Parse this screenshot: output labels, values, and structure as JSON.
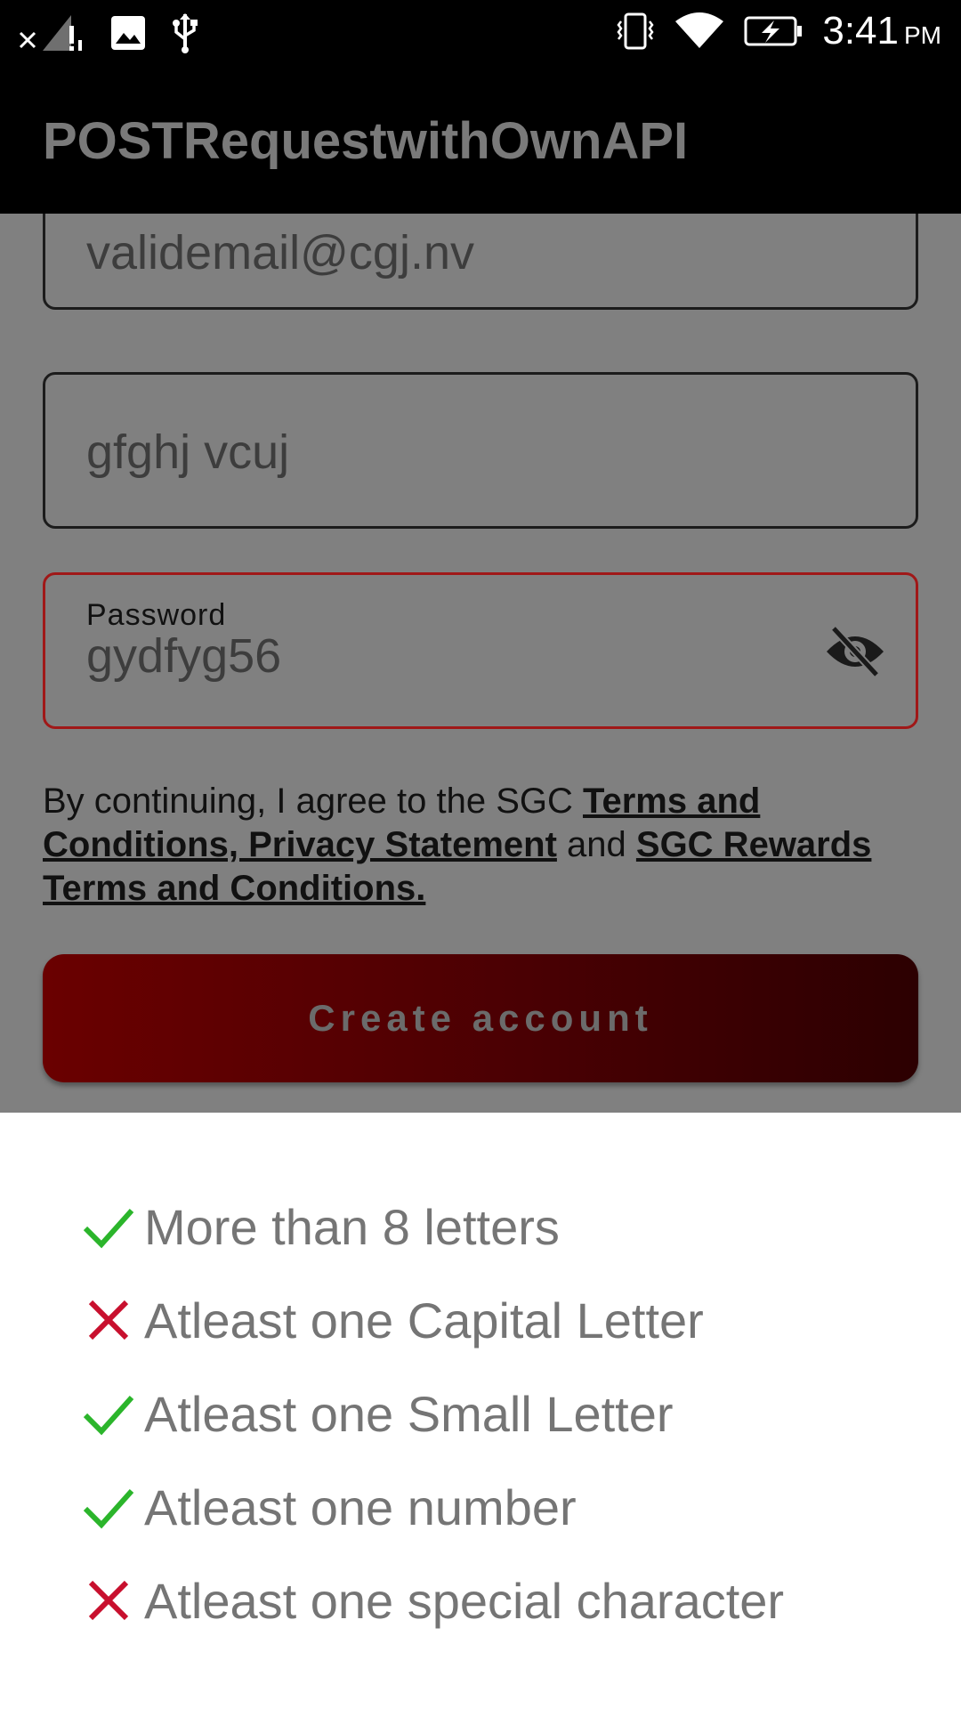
{
  "status_bar": {
    "time": "3:41",
    "ampm": "PM",
    "icons": [
      "close-icon",
      "no-signal-icon",
      "image-icon",
      "usb-icon",
      "vibrate-icon",
      "wifi-icon",
      "battery-charging-icon"
    ]
  },
  "app_bar": {
    "title": "POSTRequestwithOwnAPI"
  },
  "form": {
    "email_value": "validemail@cgj.nv",
    "name_value": "gfghj vcuj",
    "password_label": "Password",
    "password_value": "gydfyg56",
    "terms": {
      "prefix": "By continuing, I agree to the SGC ",
      "link1": "Terms and Conditions, Privacy Statement",
      "middle": " and ",
      "link2": "SGC Rewards Terms and Conditions."
    },
    "create_button": "Create account",
    "colors": {
      "error_border": "#a01818",
      "button_start": "#6a0000",
      "button_end": "#2c0001"
    }
  },
  "password_rules": [
    {
      "text": "More than 8 letters",
      "met": true
    },
    {
      "text": "Atleast one Capital Letter",
      "met": false
    },
    {
      "text": "Atleast one Small Letter",
      "met": true
    },
    {
      "text": "Atleast one number",
      "met": true
    },
    {
      "text": "Atleast one special character",
      "met": false
    }
  ],
  "colors": {
    "check": "#2bb52b",
    "cross": "#c8102e"
  }
}
